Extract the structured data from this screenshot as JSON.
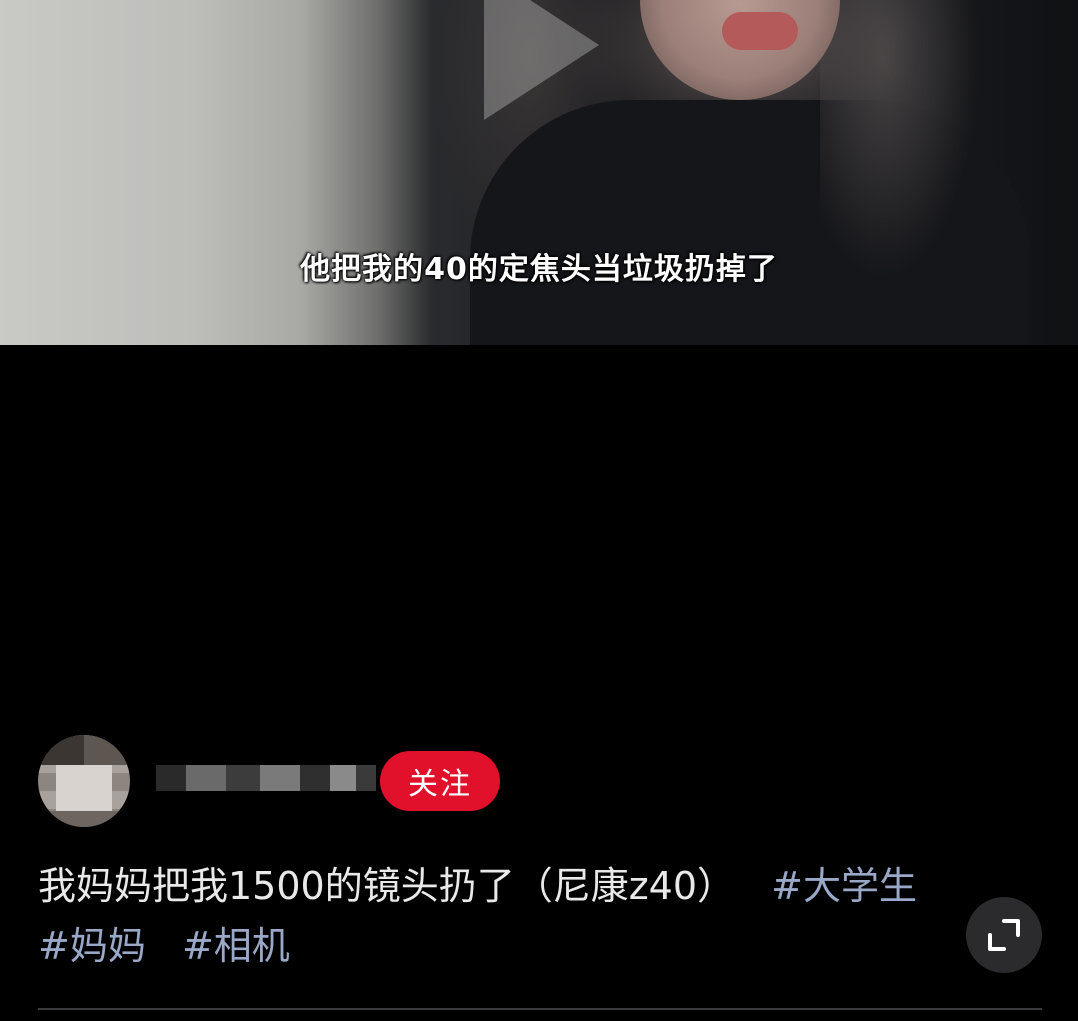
{
  "video": {
    "subtitle": "他把我的40的定焦头当垃圾扔掉了"
  },
  "author": {
    "follow_label": "关注"
  },
  "post": {
    "caption_text": "我妈妈把我1500的镜头扔了（尼康z40）",
    "hashtags": [
      "#大学生",
      "#妈妈",
      "#相机"
    ]
  },
  "icons": {
    "play": "play-icon",
    "expand": "expand-icon"
  },
  "colors": {
    "background": "#000000",
    "follow_button": "#e1112b",
    "hashtag": "#9aa8c8",
    "caption": "#e9e9ea"
  }
}
